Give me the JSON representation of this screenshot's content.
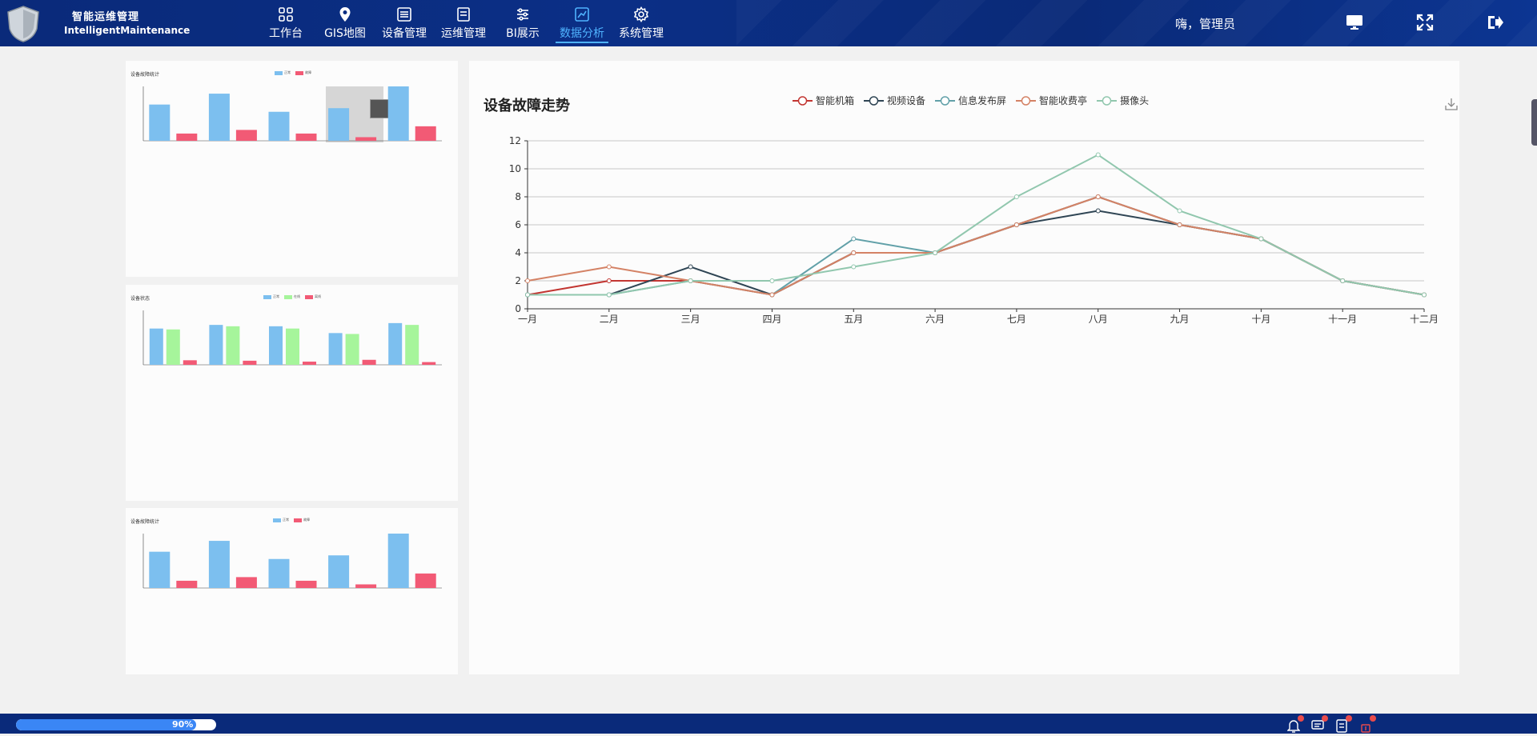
{
  "header": {
    "brand_cn": "智能运维管理",
    "brand_en": "IntelligentMaintenance",
    "greeting": "嗨，管理员",
    "nav": [
      {
        "label": "工作台",
        "icon": "grid-icon"
      },
      {
        "label": "GIS地图",
        "icon": "location-pin-icon"
      },
      {
        "label": "设备管理",
        "icon": "device-list-icon"
      },
      {
        "label": "运维管理",
        "icon": "document-icon"
      },
      {
        "label": "BI展示",
        "icon": "sliders-icon"
      },
      {
        "label": "数据分析",
        "icon": "trend-chart-icon",
        "active": true
      },
      {
        "label": "系统管理",
        "icon": "gear-icon"
      }
    ]
  },
  "accent": "#4fb3ff",
  "mini_charts": [
    {
      "title": "设备故障统计",
      "legend": [
        "正常",
        "故障"
      ],
      "colors": [
        "#7cbfef",
        "#f25a75"
      ]
    },
    {
      "title": "设备状态",
      "legend": [
        "正常",
        "在线",
        "离线"
      ],
      "colors": [
        "#7cbfef",
        "#a6f59b",
        "#f25a75"
      ]
    },
    {
      "title": "设备故障统计",
      "legend": [
        "正常",
        "故障"
      ],
      "colors": [
        "#7cbfef",
        "#f25a75"
      ]
    }
  ],
  "chart_data": [
    {
      "type": "bar",
      "title": "设备故障统计",
      "categories": [
        "",
        "",
        "",
        "",
        ""
      ],
      "series": [
        {
          "name": "正常",
          "values": [
            10,
            13,
            8,
            9,
            15
          ]
        },
        {
          "name": "故障",
          "values": [
            2,
            3,
            2,
            1,
            4
          ]
        }
      ],
      "ylim": [
        0,
        15
      ]
    },
    {
      "type": "bar",
      "title": "设备状态",
      "categories": [
        "",
        "",
        "",
        "",
        ""
      ],
      "series": [
        {
          "name": "正常",
          "values": [
            80,
            88,
            85,
            70,
            92
          ]
        },
        {
          "name": "在线",
          "values": [
            78,
            85,
            80,
            68,
            88
          ]
        },
        {
          "name": "离线",
          "values": [
            10,
            9,
            7,
            11,
            6
          ]
        }
      ],
      "ylim": [
        0,
        120
      ]
    },
    {
      "type": "bar",
      "title": "设备故障统计",
      "categories": [
        "",
        "",
        "",
        "",
        ""
      ],
      "series": [
        {
          "name": "正常",
          "values": [
            10,
            13,
            8,
            9,
            15
          ]
        },
        {
          "name": "故障",
          "values": [
            2,
            3,
            2,
            1,
            4
          ]
        }
      ],
      "ylim": [
        0,
        15
      ]
    },
    {
      "type": "line",
      "title": "设备故障走势",
      "categories": [
        "一月",
        "二月",
        "三月",
        "四月",
        "五月",
        "六月",
        "七月",
        "八月",
        "九月",
        "十月",
        "十一月",
        "十二月"
      ],
      "ylim": [
        0,
        12
      ],
      "yticks": [
        0,
        2,
        4,
        6,
        8,
        10,
        12
      ],
      "grid": true,
      "legend_position": "top",
      "series": [
        {
          "name": "智能机箱",
          "color": "#c23531",
          "values": [
            1,
            2,
            2,
            1,
            4,
            4,
            6,
            8,
            6,
            5,
            2,
            1
          ]
        },
        {
          "name": "视频设备",
          "color": "#2f4554",
          "values": [
            1,
            1,
            3,
            1,
            4,
            4,
            6,
            7,
            6,
            5,
            2,
            1
          ]
        },
        {
          "name": "信息发布屏",
          "color": "#61a0a8",
          "values": [
            1,
            1,
            2,
            1,
            5,
            4,
            6,
            8,
            6,
            5,
            2,
            1
          ]
        },
        {
          "name": "智能收费亭",
          "color": "#d48265",
          "values": [
            2,
            3,
            2,
            1,
            4,
            4,
            6,
            8,
            6,
            5,
            2,
            1
          ]
        },
        {
          "name": "摄像头",
          "color": "#91c7ae",
          "values": [
            1,
            1,
            2,
            2,
            3,
            4,
            8,
            11,
            7,
            5,
            2,
            1
          ]
        }
      ]
    }
  ],
  "progress": {
    "label": "90%",
    "value": 90
  }
}
